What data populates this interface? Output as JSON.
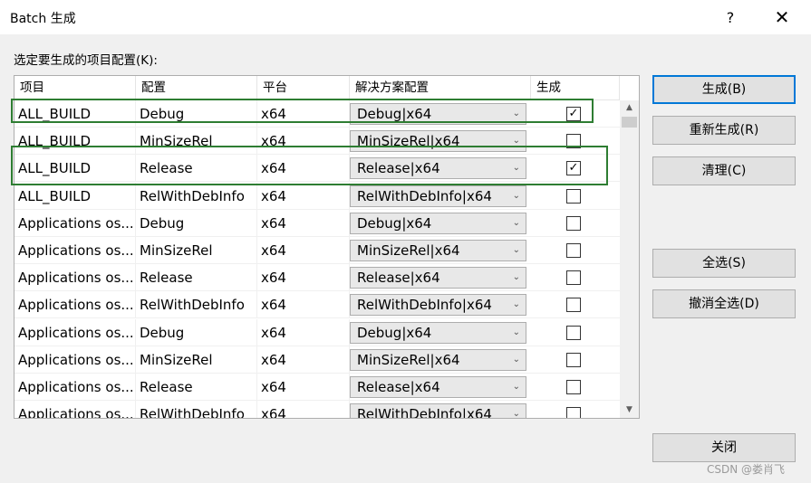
{
  "window": {
    "title": "Batch 生成",
    "help_label": "?",
    "close_label": "✕"
  },
  "prompt": "选定要生成的项目配置(K):",
  "columns": [
    "项目",
    "配置",
    "平台",
    "解决方案配置",
    "生成"
  ],
  "rows": [
    {
      "project": "ALL_BUILD",
      "config": "Debug",
      "platform": "x64",
      "solution": "Debug|x64",
      "build": true
    },
    {
      "project": "ALL_BUILD",
      "config": "MinSizeRel",
      "platform": "x64",
      "solution": "MinSizeRel|x64",
      "build": false
    },
    {
      "project": "ALL_BUILD",
      "config": "Release",
      "platform": "x64",
      "solution": "Release|x64",
      "build": true
    },
    {
      "project": "ALL_BUILD",
      "config": "RelWithDebInfo",
      "platform": "x64",
      "solution": "RelWithDebInfo|x64",
      "build": false
    },
    {
      "project": "Applications os...",
      "config": "Debug",
      "platform": "x64",
      "solution": "Debug|x64",
      "build": false
    },
    {
      "project": "Applications os...",
      "config": "MinSizeRel",
      "platform": "x64",
      "solution": "MinSizeRel|x64",
      "build": false
    },
    {
      "project": "Applications os...",
      "config": "Release",
      "platform": "x64",
      "solution": "Release|x64",
      "build": false
    },
    {
      "project": "Applications os...",
      "config": "RelWithDebInfo",
      "platform": "x64",
      "solution": "RelWithDebInfo|x64",
      "build": false
    },
    {
      "project": "Applications os...",
      "config": "Debug",
      "platform": "x64",
      "solution": "Debug|x64",
      "build": false
    },
    {
      "project": "Applications os...",
      "config": "MinSizeRel",
      "platform": "x64",
      "solution": "MinSizeRel|x64",
      "build": false
    },
    {
      "project": "Applications os...",
      "config": "Release",
      "platform": "x64",
      "solution": "Release|x64",
      "build": false
    },
    {
      "project": "Applications os...",
      "config": "RelWithDebInfo",
      "platform": "x64",
      "solution": "RelWithDebInfo|x64",
      "build": false
    }
  ],
  "buttons": {
    "build": "生成(B)",
    "rebuild": "重新生成(R)",
    "clean": "清理(C)",
    "select_all": "全选(S)",
    "deselect_all": "撤消全选(D)",
    "close": "关闭"
  },
  "watermark": "CSDN @娄肖飞",
  "colors": {
    "highlight_box": "#2e7d32",
    "default_button_border": "#0078d7"
  }
}
